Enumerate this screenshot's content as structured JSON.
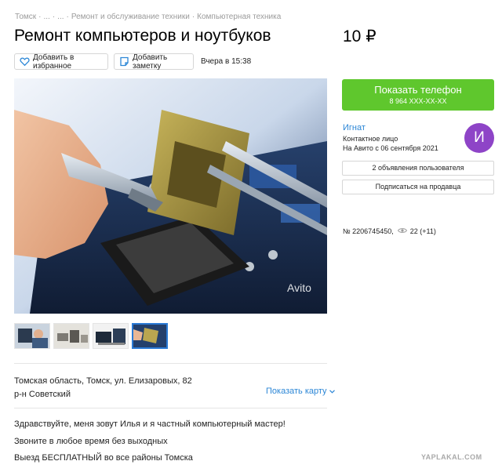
{
  "breadcrumb": [
    "Томск",
    "...",
    "...",
    "Ремонт и обслуживание техники",
    "Компьютерная техника"
  ],
  "breadcrumb_separator": "·",
  "title": "Ремонт компьютеров и ноутбуков",
  "price": "10 ₽",
  "actions": {
    "favorite_label": "Добавить в избранное",
    "note_label": "Добавить заметку",
    "posted": "Вчера в 15:38"
  },
  "photo": {
    "watermark_label": "Avito",
    "thumbnail_count": 4,
    "active_thumbnail": 4
  },
  "location": {
    "address": "Томская область, Томск, ул. Елизаровых, 82",
    "district": "р-н Советский",
    "show_map_label": "Показать карту"
  },
  "description": [
    "Здравствуйте, меня зовут Илья и я частный компьютерный мастер!",
    "Звоните в любое время без выходных",
    "Выезд БЕСПЛАТНЫЙ во все районы Томска"
  ],
  "contact": {
    "phone_button_label": "Показать телефон",
    "phone_masked": "8 964 XXX-XX-XX"
  },
  "seller": {
    "name": "Игнат",
    "role": "Контактное лицо",
    "since": "На Авито с 06 сентября 2021",
    "avatar_letter": "И",
    "avatar_color": "#8e44c7",
    "ads_button_label": "2 объявления пользователя",
    "subscribe_label": "Подписаться на продавца"
  },
  "ad": {
    "number": "№ 2206745450,",
    "views": "22 (+11)"
  },
  "site_watermark": "YAPLAKAL.COM",
  "colors": {
    "accent_green": "#5fc72d",
    "link_blue": "#2b86d6",
    "thumb_active_border": "#2b7bd6"
  }
}
